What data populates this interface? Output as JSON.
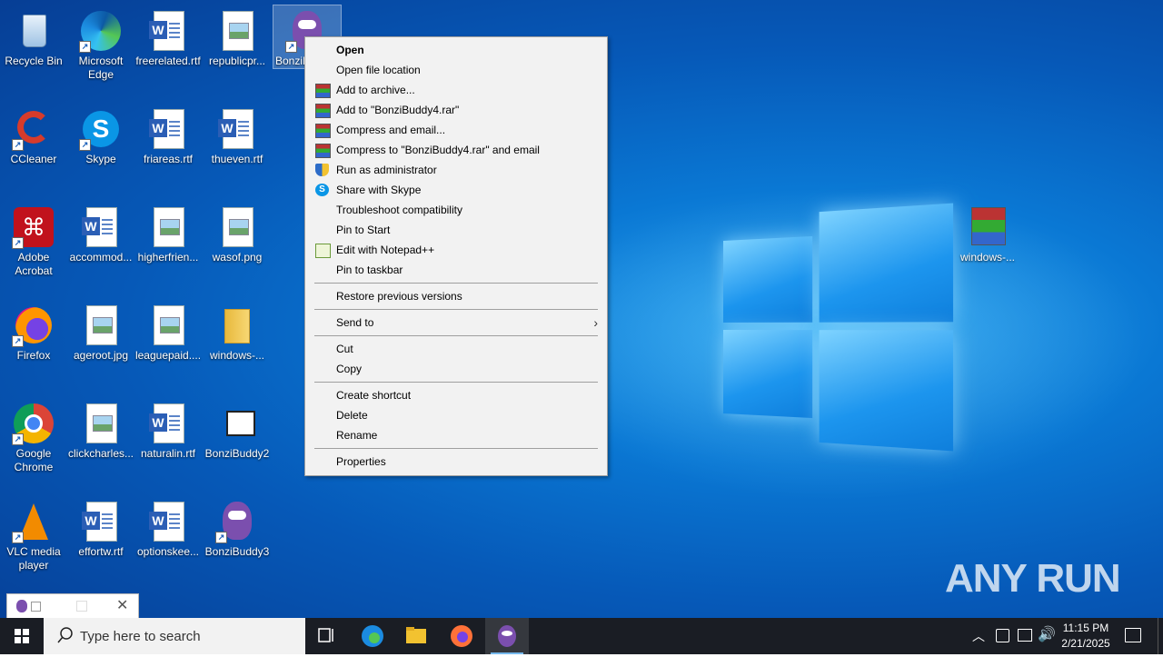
{
  "desktop_icons": [
    {
      "label": "Recycle Bin"
    },
    {
      "label": "Microsoft Edge"
    },
    {
      "label": "freerelated.rtf"
    },
    {
      "label": "republicpr..."
    },
    {
      "label": "BonziB"
    },
    {
      "label": "CCleaner"
    },
    {
      "label": "Skype"
    },
    {
      "label": "friareas.rtf"
    },
    {
      "label": "thueven.rtf"
    },
    {
      "label": "Adobe Acrobat"
    },
    {
      "label": "accommod..."
    },
    {
      "label": "higherfrien..."
    },
    {
      "label": "wasof.png"
    },
    {
      "label": "Firefox"
    },
    {
      "label": "ageroot.jpg"
    },
    {
      "label": "leaguepaid...."
    },
    {
      "label": "windows-..."
    },
    {
      "label": "Google Chrome"
    },
    {
      "label": "clickcharles..."
    },
    {
      "label": "naturalin.rtf"
    },
    {
      "label": "BonziBuddy2"
    },
    {
      "label": "VLC media player"
    },
    {
      "label": "effortw.rtf"
    },
    {
      "label": "optionskee..."
    },
    {
      "label": "BonziBuddy3"
    },
    {
      "label": "windows-..."
    }
  ],
  "context_menu": {
    "items": [
      {
        "label": "Open"
      },
      {
        "label": "Open file location"
      },
      {
        "label": "Add to archive..."
      },
      {
        "label": "Add to \"BonziBuddy4.rar\""
      },
      {
        "label": "Compress and email..."
      },
      {
        "label": "Compress to \"BonziBuddy4.rar\" and email"
      },
      {
        "label": "Run as administrator"
      },
      {
        "label": "Share with Skype"
      },
      {
        "label": "Troubleshoot compatibility"
      },
      {
        "label": "Pin to Start"
      },
      {
        "label": "Edit with Notepad++"
      },
      {
        "label": "Pin to taskbar"
      },
      {
        "label": "Restore previous versions"
      },
      {
        "label": "Send to"
      },
      {
        "label": "Cut"
      },
      {
        "label": "Copy"
      },
      {
        "label": "Create shortcut"
      },
      {
        "label": "Delete"
      },
      {
        "label": "Rename"
      },
      {
        "label": "Properties"
      }
    ]
  },
  "taskbar": {
    "search_placeholder": "Type here to search",
    "time": "11:15 PM",
    "date": "2/21/2025"
  },
  "watermark": "ANY RUN",
  "colors": {
    "accent": "#0a78d4",
    "menu_bg": "#f2f2f2",
    "taskbar_bg": "#1a1d24"
  }
}
